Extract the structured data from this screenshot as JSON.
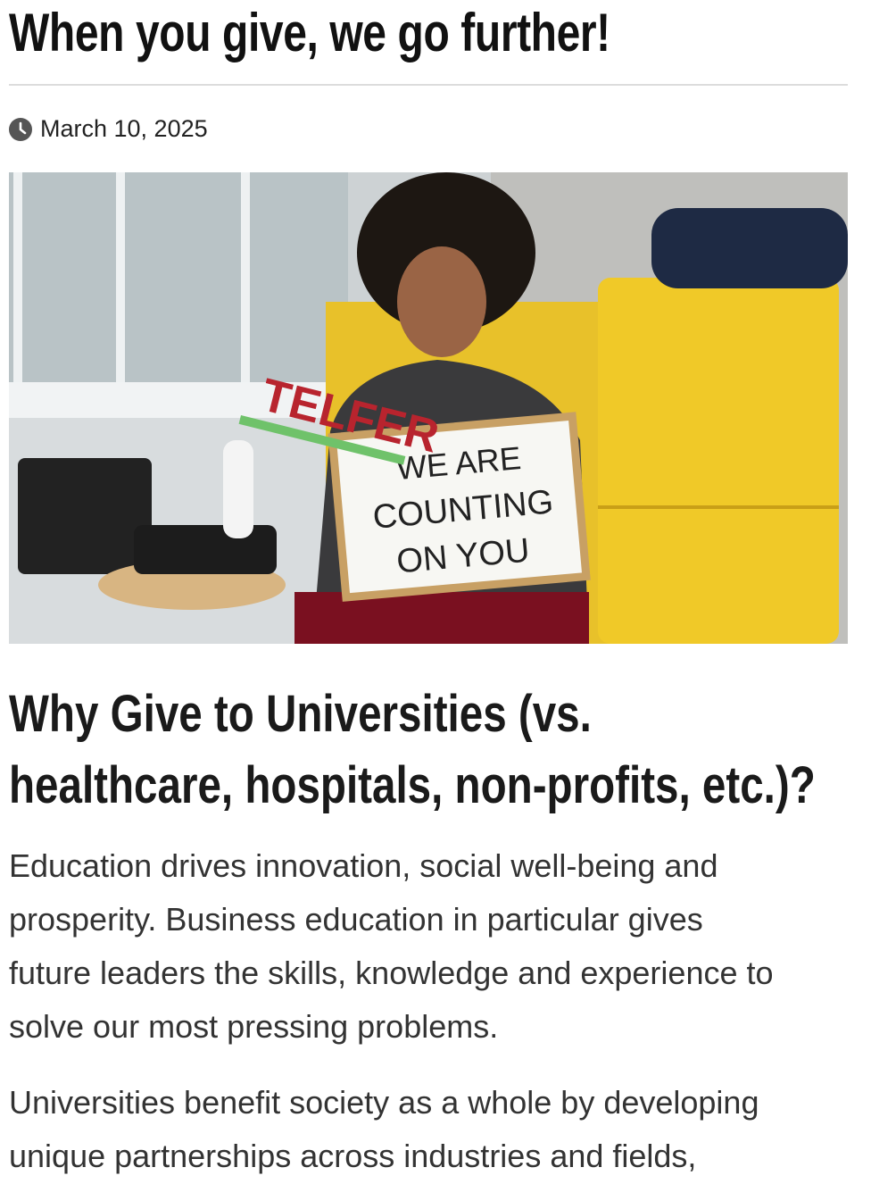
{
  "article": {
    "title": "When you give, we go further!",
    "date": "March 10, 2025",
    "date_icon": "clock-icon",
    "photo": {
      "sign_lines": [
        "WE ARE",
        "COUNTING",
        "ON YOU"
      ],
      "logo_text": "TELFER"
    },
    "section_heading_lines": [
      "Why Give to Universities (vs.",
      "healthcare, hospitals, non-profits, etc.)?"
    ],
    "paragraph1_lines": [
      "Education drives innovation, social well-being and",
      "prosperity. Business education in particular gives",
      "future leaders the skills, knowledge and experience to",
      "solve our most pressing problems."
    ],
    "paragraph2_lines": [
      "Universities benefit society as a whole by developing",
      "unique partnerships across industries and fields,"
    ]
  }
}
